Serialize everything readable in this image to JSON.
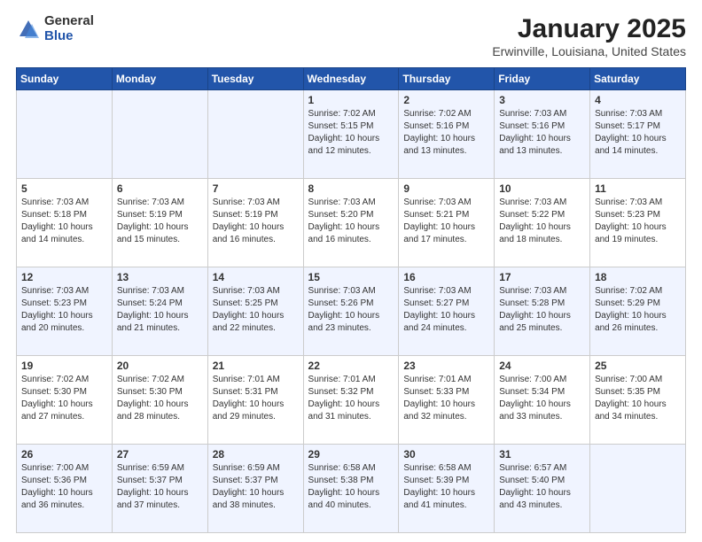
{
  "logo": {
    "general": "General",
    "blue": "Blue"
  },
  "title": {
    "month": "January 2025",
    "location": "Erwinville, Louisiana, United States"
  },
  "headers": [
    "Sunday",
    "Monday",
    "Tuesday",
    "Wednesday",
    "Thursday",
    "Friday",
    "Saturday"
  ],
  "weeks": [
    [
      {
        "day": "",
        "info": ""
      },
      {
        "day": "",
        "info": ""
      },
      {
        "day": "",
        "info": ""
      },
      {
        "day": "1",
        "info": "Sunrise: 7:02 AM\nSunset: 5:15 PM\nDaylight: 10 hours\nand 12 minutes."
      },
      {
        "day": "2",
        "info": "Sunrise: 7:02 AM\nSunset: 5:16 PM\nDaylight: 10 hours\nand 13 minutes."
      },
      {
        "day": "3",
        "info": "Sunrise: 7:03 AM\nSunset: 5:16 PM\nDaylight: 10 hours\nand 13 minutes."
      },
      {
        "day": "4",
        "info": "Sunrise: 7:03 AM\nSunset: 5:17 PM\nDaylight: 10 hours\nand 14 minutes."
      }
    ],
    [
      {
        "day": "5",
        "info": "Sunrise: 7:03 AM\nSunset: 5:18 PM\nDaylight: 10 hours\nand 14 minutes."
      },
      {
        "day": "6",
        "info": "Sunrise: 7:03 AM\nSunset: 5:19 PM\nDaylight: 10 hours\nand 15 minutes."
      },
      {
        "day": "7",
        "info": "Sunrise: 7:03 AM\nSunset: 5:19 PM\nDaylight: 10 hours\nand 16 minutes."
      },
      {
        "day": "8",
        "info": "Sunrise: 7:03 AM\nSunset: 5:20 PM\nDaylight: 10 hours\nand 16 minutes."
      },
      {
        "day": "9",
        "info": "Sunrise: 7:03 AM\nSunset: 5:21 PM\nDaylight: 10 hours\nand 17 minutes."
      },
      {
        "day": "10",
        "info": "Sunrise: 7:03 AM\nSunset: 5:22 PM\nDaylight: 10 hours\nand 18 minutes."
      },
      {
        "day": "11",
        "info": "Sunrise: 7:03 AM\nSunset: 5:23 PM\nDaylight: 10 hours\nand 19 minutes."
      }
    ],
    [
      {
        "day": "12",
        "info": "Sunrise: 7:03 AM\nSunset: 5:23 PM\nDaylight: 10 hours\nand 20 minutes."
      },
      {
        "day": "13",
        "info": "Sunrise: 7:03 AM\nSunset: 5:24 PM\nDaylight: 10 hours\nand 21 minutes."
      },
      {
        "day": "14",
        "info": "Sunrise: 7:03 AM\nSunset: 5:25 PM\nDaylight: 10 hours\nand 22 minutes."
      },
      {
        "day": "15",
        "info": "Sunrise: 7:03 AM\nSunset: 5:26 PM\nDaylight: 10 hours\nand 23 minutes."
      },
      {
        "day": "16",
        "info": "Sunrise: 7:03 AM\nSunset: 5:27 PM\nDaylight: 10 hours\nand 24 minutes."
      },
      {
        "day": "17",
        "info": "Sunrise: 7:03 AM\nSunset: 5:28 PM\nDaylight: 10 hours\nand 25 minutes."
      },
      {
        "day": "18",
        "info": "Sunrise: 7:02 AM\nSunset: 5:29 PM\nDaylight: 10 hours\nand 26 minutes."
      }
    ],
    [
      {
        "day": "19",
        "info": "Sunrise: 7:02 AM\nSunset: 5:30 PM\nDaylight: 10 hours\nand 27 minutes."
      },
      {
        "day": "20",
        "info": "Sunrise: 7:02 AM\nSunset: 5:30 PM\nDaylight: 10 hours\nand 28 minutes."
      },
      {
        "day": "21",
        "info": "Sunrise: 7:01 AM\nSunset: 5:31 PM\nDaylight: 10 hours\nand 29 minutes."
      },
      {
        "day": "22",
        "info": "Sunrise: 7:01 AM\nSunset: 5:32 PM\nDaylight: 10 hours\nand 31 minutes."
      },
      {
        "day": "23",
        "info": "Sunrise: 7:01 AM\nSunset: 5:33 PM\nDaylight: 10 hours\nand 32 minutes."
      },
      {
        "day": "24",
        "info": "Sunrise: 7:00 AM\nSunset: 5:34 PM\nDaylight: 10 hours\nand 33 minutes."
      },
      {
        "day": "25",
        "info": "Sunrise: 7:00 AM\nSunset: 5:35 PM\nDaylight: 10 hours\nand 34 minutes."
      }
    ],
    [
      {
        "day": "26",
        "info": "Sunrise: 7:00 AM\nSunset: 5:36 PM\nDaylight: 10 hours\nand 36 minutes."
      },
      {
        "day": "27",
        "info": "Sunrise: 6:59 AM\nSunset: 5:37 PM\nDaylight: 10 hours\nand 37 minutes."
      },
      {
        "day": "28",
        "info": "Sunrise: 6:59 AM\nSunset: 5:37 PM\nDaylight: 10 hours\nand 38 minutes."
      },
      {
        "day": "29",
        "info": "Sunrise: 6:58 AM\nSunset: 5:38 PM\nDaylight: 10 hours\nand 40 minutes."
      },
      {
        "day": "30",
        "info": "Sunrise: 6:58 AM\nSunset: 5:39 PM\nDaylight: 10 hours\nand 41 minutes."
      },
      {
        "day": "31",
        "info": "Sunrise: 6:57 AM\nSunset: 5:40 PM\nDaylight: 10 hours\nand 43 minutes."
      },
      {
        "day": "",
        "info": ""
      }
    ]
  ]
}
